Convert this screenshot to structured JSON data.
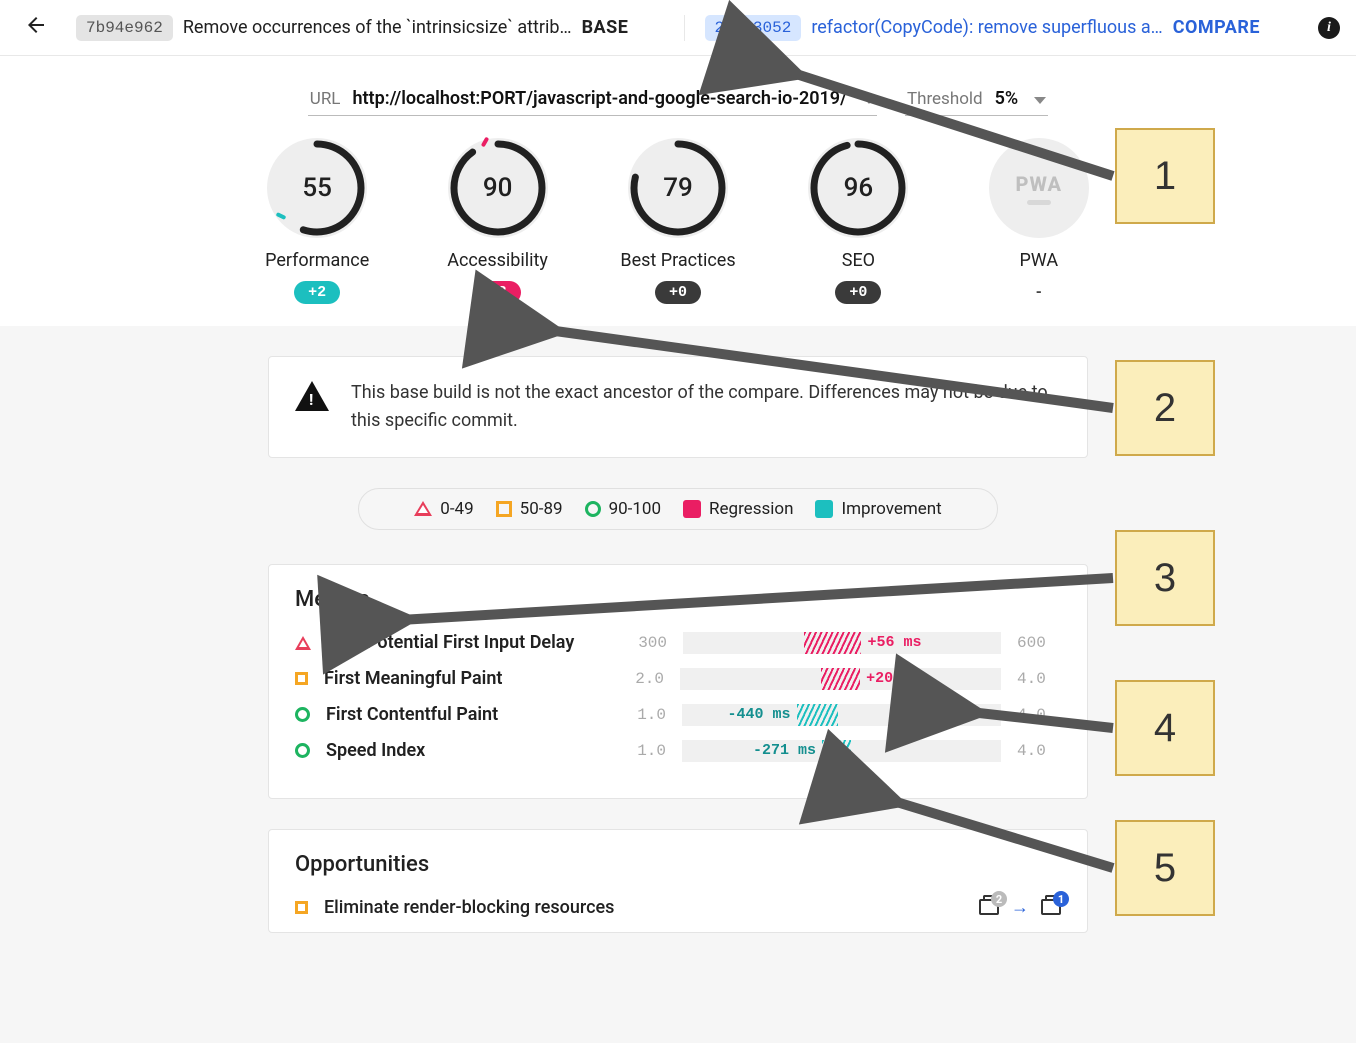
{
  "header": {
    "base": {
      "hash": "7b94e962",
      "message": "Remove occurrences of the `intrinsicsize` attrib…",
      "tag": "BASE"
    },
    "compare": {
      "hash": "2f783052",
      "message": "refactor(CopyCode): remove superfluous a…",
      "tag": "COMPARE"
    }
  },
  "controls": {
    "url_label": "URL",
    "url_value": "http://localhost:PORT/javascript-and-google-search-io-2019/",
    "threshold_label": "Threshold",
    "threshold_value": "5%"
  },
  "gauges": [
    {
      "label": "Performance",
      "score": "55",
      "pct": 55,
      "delta": "+2",
      "delta_class": "pos"
    },
    {
      "label": "Accessibility",
      "score": "90",
      "pct": 90,
      "delta": "-8",
      "delta_class": "neg"
    },
    {
      "label": "Best Practices",
      "score": "79",
      "pct": 79,
      "delta": "+0",
      "delta_class": "zero"
    },
    {
      "label": "SEO",
      "score": "96",
      "pct": 96,
      "delta": "+0",
      "delta_class": "zero"
    },
    {
      "label": "PWA",
      "score": "",
      "pct": 0,
      "delta": "-",
      "delta_class": "na",
      "pwa": true
    }
  ],
  "warning": "This base build is not the exact ancestor of the compare. Differences may not be due to this specific commit.",
  "legend": {
    "poor": "0-49",
    "avg": "50-89",
    "good": "90-100",
    "regression": "Regression",
    "improvement": "Improvement"
  },
  "metrics": {
    "title": "Metrics",
    "rows": [
      {
        "name": "Max Potential First Input Delay",
        "shape": "tri",
        "min": "300",
        "max": "600",
        "delta": "+56 ms",
        "type": "reg",
        "start": 38,
        "width": 18,
        "label_side": "right"
      },
      {
        "name": "First Meaningful Paint",
        "shape": "sq",
        "min": "2.0",
        "max": "4.0",
        "delta": "+209 ms",
        "type": "reg",
        "start": 44,
        "width": 12,
        "label_side": "right"
      },
      {
        "name": "First Contentful Paint",
        "shape": "ci",
        "min": "1.0",
        "max": "4.0",
        "delta": "-440 ms",
        "type": "imp",
        "start": 36,
        "width": 13,
        "label_side": "left"
      },
      {
        "name": "Speed Index",
        "shape": "ci",
        "min": "1.0",
        "max": "4.0",
        "delta": "-271 ms",
        "type": "imp",
        "start": 44,
        "width": 9,
        "label_side": "left"
      }
    ]
  },
  "opportunities": {
    "title": "Opportunities",
    "rows": [
      {
        "name": "Eliminate render-blocking resources",
        "shape": "sq",
        "badge_left": "2",
        "badge_right": "1"
      }
    ]
  },
  "callouts": {
    "c1": "1",
    "c2": "2",
    "c3": "3",
    "c4": "4",
    "c5": "5"
  }
}
